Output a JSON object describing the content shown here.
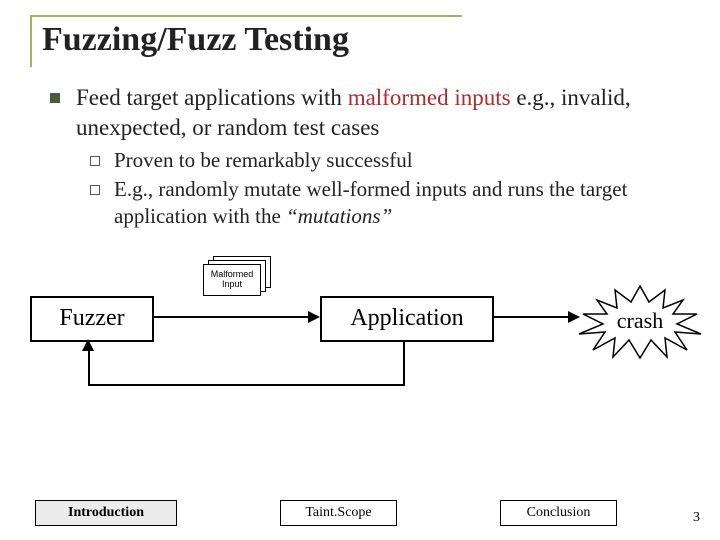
{
  "title": "Fuzzing/Fuzz Testing",
  "bullet1_pre": "Feed target applications with ",
  "bullet1_mal": "malformed inputs",
  "bullet1_post": " e.g., invalid, unexpected, or random test cases",
  "sub1": "Proven to be remarkably successful",
  "sub2_pre": "E.g., randomly mutate well-formed inputs and runs the target application with the ",
  "sub2_mut": "“mutations”",
  "diagram": {
    "fuzzer": "Fuzzer",
    "malformed_input": "Malformed Input",
    "application": "Application",
    "crash": "crash"
  },
  "footer": {
    "intro": "Introduction",
    "taint": "Taint.Scope",
    "conclusion": "Conclusion",
    "page": "3"
  }
}
